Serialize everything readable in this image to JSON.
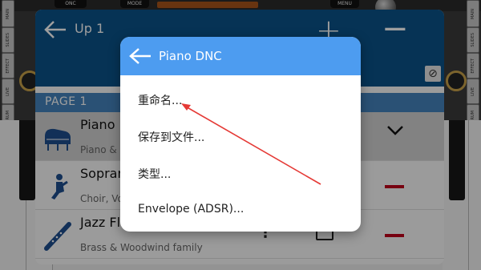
{
  "hardware": {
    "top_labels": [
      "ONC",
      "MODE",
      "MENU"
    ],
    "side_tabs_left": [
      "MAIN",
      "SLIDES",
      "EFFECT",
      "LIVE",
      "DRUM"
    ],
    "side_tabs_right": [
      "MAIN",
      "SLIDES",
      "EFFECT",
      "LIVE",
      "DRUM"
    ]
  },
  "app": {
    "title": "Up 1",
    "header_icons": [
      "back-arrow-icon",
      "plus-icon",
      "minus-icon",
      "no-sign-icon"
    ],
    "page_label": "PAGE 1",
    "instruments": [
      {
        "name": "Piano DNC",
        "family": "Piano & Keyboard",
        "icon": "grand-piano-icon"
      },
      {
        "name": "Soprano",
        "family": "Choir, Vocals",
        "icon": "singer-icon"
      },
      {
        "name": "Jazz Flute",
        "family": "Brass & Woodwind family",
        "icon": "flute-icon"
      }
    ]
  },
  "menu": {
    "title": "Piano DNC",
    "items": [
      "重命名...",
      "保存到文件...",
      "类型...",
      "Envelope (ADSR)..."
    ]
  },
  "colors": {
    "app_header": "#0b5389",
    "page_bar": "#4583bd",
    "menu_header": "#4d9cf0",
    "accent_red": "#c0001b",
    "annotation_arrow": "#e53935"
  }
}
